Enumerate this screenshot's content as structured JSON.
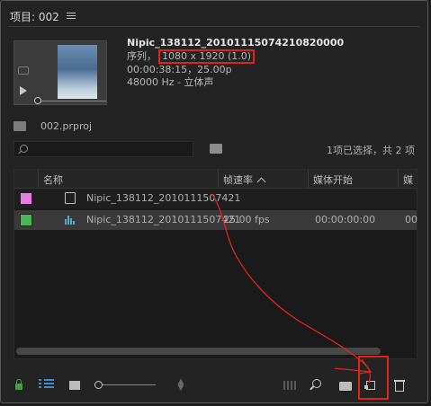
{
  "header": {
    "title": "项目: 002",
    "menu_icon": "hamburger-icon"
  },
  "preview": {
    "clip_name": "Nipic_138112_20101115074210820000",
    "type_label": "序列，",
    "resolution": "1080 x 1920 (1.0)",
    "timing": "00:00:38:15，25.00p",
    "audio": "48000 Hz - 立体声"
  },
  "project": {
    "file_name": "002.prproj"
  },
  "search": {
    "placeholder": "",
    "status": "1项已选择，共 2 项"
  },
  "table": {
    "columns": [
      "名称",
      "帧速率",
      "媒体开始",
      "媒"
    ],
    "rows": [
      {
        "color": "#e57ee6",
        "icon": "sequence-icon",
        "name": "Nipic_138112_2010111507421",
        "fps": "",
        "start": "",
        "extra": ""
      },
      {
        "color": "#49b555",
        "icon": "clip-icon",
        "name": "Nipic_138112_2010111507421",
        "fps": "25.00 fps",
        "start": "00:00:00:00",
        "extra": "00"
      }
    ]
  },
  "footer": {
    "icons": [
      "lock-icon",
      "list-view-icon",
      "icon-view-icon",
      "zoom-slider",
      "sort-icon",
      "automate-to-sequence-icon",
      "find-icon",
      "new-bin-icon",
      "new-item-icon",
      "clear-icon"
    ]
  },
  "colors": {
    "annotation": "#e0241a",
    "panel_bg": "#232323"
  }
}
